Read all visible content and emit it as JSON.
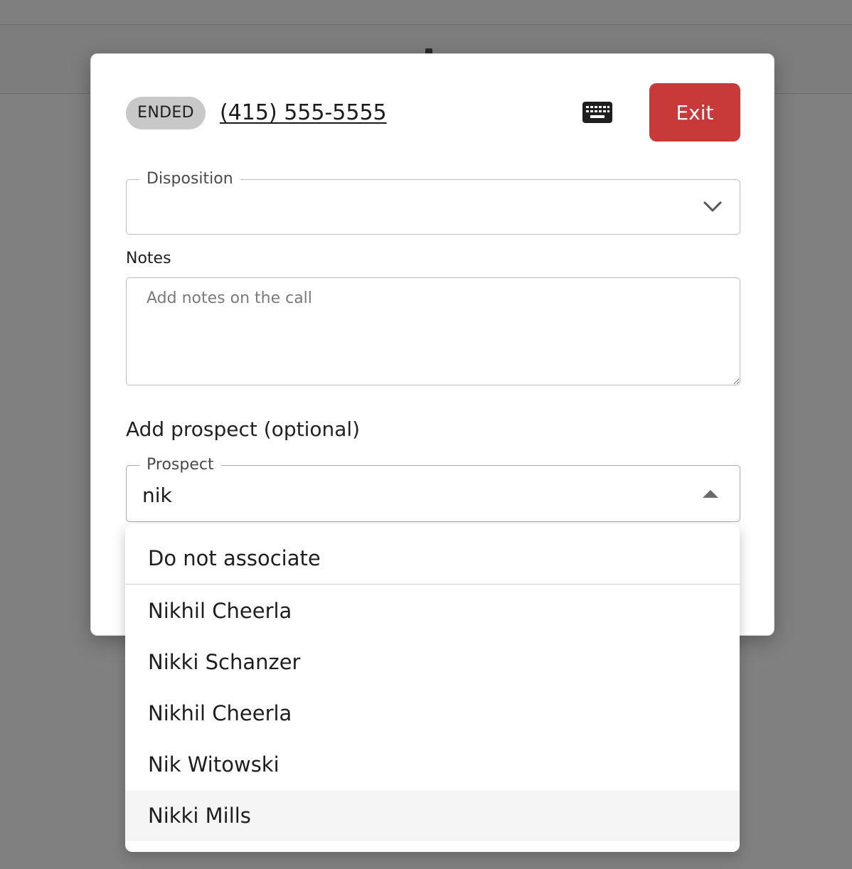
{
  "call": {
    "status": "ENDED",
    "phone_number": "(415) 555-5555",
    "exit_label": "Exit"
  },
  "disposition": {
    "label": "Disposition",
    "value": ""
  },
  "notes": {
    "label": "Notes",
    "placeholder": "Add notes on the call",
    "value": ""
  },
  "prospect_section": {
    "heading": "Add prospect (optional)",
    "field_label": "Prospect",
    "search_value": "nik"
  },
  "prospect_options": {
    "default_option": "Do not associate",
    "results": [
      "Nikhil Cheerla",
      "Nikki Schanzer",
      "Nikhil Cheerla",
      "Nik Witowski",
      "Nikki Mills"
    ],
    "highlighted_index": 4
  },
  "icons": {
    "keypad": "keyboard-icon",
    "disposition_toggle": "chevron-down-icon",
    "prospect_toggle": "caret-up-icon"
  },
  "colors": {
    "exit_button": "#c8393a",
    "status_badge_bg": "#c8c8c8",
    "overlay": "#808080"
  }
}
